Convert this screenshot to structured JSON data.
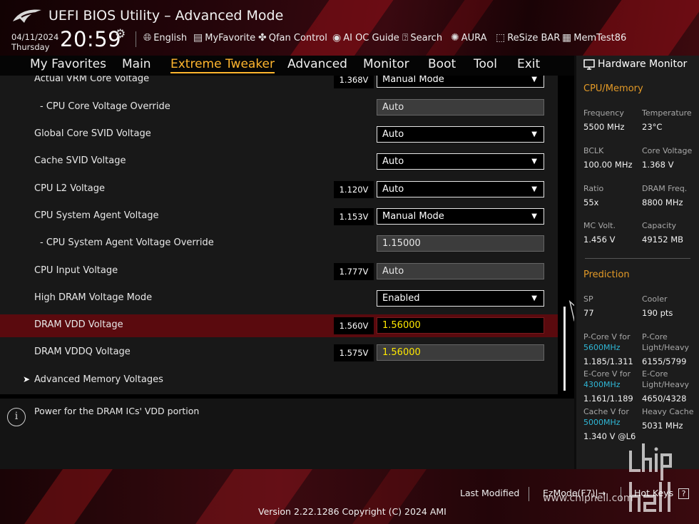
{
  "app": {
    "title": "UEFI BIOS Utility – Advanced Mode"
  },
  "datetime": {
    "date": "04/11/2024",
    "day": "Thursday",
    "time": "20:59"
  },
  "toolbar": [
    {
      "icon": "globe-icon",
      "label": "English"
    },
    {
      "icon": "favorite-icon",
      "label": "MyFavorite"
    },
    {
      "icon": "fan-icon",
      "label": "Qfan Control"
    },
    {
      "icon": "ai-oc-icon",
      "label": "AI OC Guide"
    },
    {
      "icon": "search-icon",
      "label": "Search"
    },
    {
      "icon": "aura-icon",
      "label": "AURA"
    },
    {
      "icon": "resize-bar-icon",
      "label": "ReSize BAR"
    },
    {
      "icon": "memtest-icon",
      "label": "MemTest86"
    }
  ],
  "tabs": [
    {
      "label": "My Favorites",
      "active": false
    },
    {
      "label": "Main",
      "active": false
    },
    {
      "label": "Extreme Tweaker",
      "active": true
    },
    {
      "label": "Advanced",
      "active": false
    },
    {
      "label": "Monitor",
      "active": false
    },
    {
      "label": "Boot",
      "active": false
    },
    {
      "label": "Tool",
      "active": false
    },
    {
      "label": "Exit",
      "active": false
    }
  ],
  "settings": [
    {
      "label": "Actual VRM Core Voltage",
      "voltage": "1.368V",
      "value": "Manual Mode",
      "control": "dropdown"
    },
    {
      "label": "- CPU Core Voltage Override",
      "voltage": "",
      "value": "Auto",
      "control": "fixed"
    },
    {
      "label": "Global Core SVID Voltage",
      "voltage": "",
      "value": "Auto",
      "control": "dropdown"
    },
    {
      "label": "Cache SVID Voltage",
      "voltage": "",
      "value": "Auto",
      "control": "dropdown"
    },
    {
      "label": "CPU L2 Voltage",
      "voltage": "1.120V",
      "value": "Auto",
      "control": "dropdown"
    },
    {
      "label": "CPU System Agent Voltage",
      "voltage": "1.153V",
      "value": "Manual Mode",
      "control": "dropdown"
    },
    {
      "label": "- CPU System Agent Voltage Override",
      "voltage": "",
      "value": "1.15000",
      "control": "fixed"
    },
    {
      "label": "CPU Input Voltage",
      "voltage": "1.777V",
      "value": "Auto",
      "control": "fixed"
    },
    {
      "label": "High DRAM Voltage Mode",
      "voltage": "",
      "value": "Enabled",
      "control": "dropdown"
    },
    {
      "label": "DRAM VDD Voltage",
      "voltage": "1.560V",
      "value": "1.56000",
      "control": "edit"
    },
    {
      "label": "DRAM VDDQ Voltage",
      "voltage": "1.575V",
      "value": "1.56000",
      "control": "fixed-yellow"
    }
  ],
  "submenu": {
    "label": "Advanced Memory Voltages"
  },
  "help": {
    "text": "Power for the DRAM ICs' VDD portion"
  },
  "hardware_monitor": {
    "title": "Hardware Monitor",
    "cpu_memory_title": "CPU/Memory",
    "cpu_memory": [
      {
        "label": "Frequency",
        "value": "5500 MHz"
      },
      {
        "label": "Temperature",
        "value": "23°C"
      },
      {
        "label": "BCLK",
        "value": "100.00 MHz"
      },
      {
        "label": "Core Voltage",
        "value": "1.368 V"
      },
      {
        "label": "Ratio",
        "value": "55x"
      },
      {
        "label": "DRAM Freq.",
        "value": "8800 MHz"
      },
      {
        "label": "MC Volt.",
        "value": "1.456 V"
      },
      {
        "label": "Capacity",
        "value": "49152 MB"
      }
    ],
    "prediction_title": "Prediction",
    "sp": {
      "label": "SP",
      "value": "77"
    },
    "cooler": {
      "label": "Cooler",
      "value": "190 pts"
    },
    "pcore_v": {
      "label": "P-Core V for",
      "freq": "5600MHz",
      "value": "1.185/1.311"
    },
    "pcore_lh": {
      "label1": "P-Core",
      "label2": "Light/Heavy",
      "value": "6155/5799"
    },
    "ecore_v": {
      "label": "E-Core V for",
      "freq": "4300MHz",
      "value": "1.161/1.189"
    },
    "ecore_lh": {
      "label1": "E-Core",
      "label2": "Light/Heavy",
      "value": "4650/4328"
    },
    "cache_v": {
      "label": "Cache V for",
      "freq": "5000MHz",
      "value": "1.340 V @L6"
    },
    "heavy_cache": {
      "label": "Heavy Cache",
      "value": "5031 MHz"
    }
  },
  "footer": {
    "last_modified": "Last Modified",
    "ezmode": "EzMode(F7)|→",
    "hotkeys": "Hot Keys",
    "version": "Version 2.22.1286 Copyright (C) 2024 AMI"
  },
  "watermark": {
    "site": "www.chiphell.com",
    "logo_text": "chip hell"
  },
  "colors": {
    "accent": "#ffb52e",
    "selection": "#5a0a0e",
    "value_yellow": "#ffe900",
    "cyan": "#2fb7d6"
  }
}
